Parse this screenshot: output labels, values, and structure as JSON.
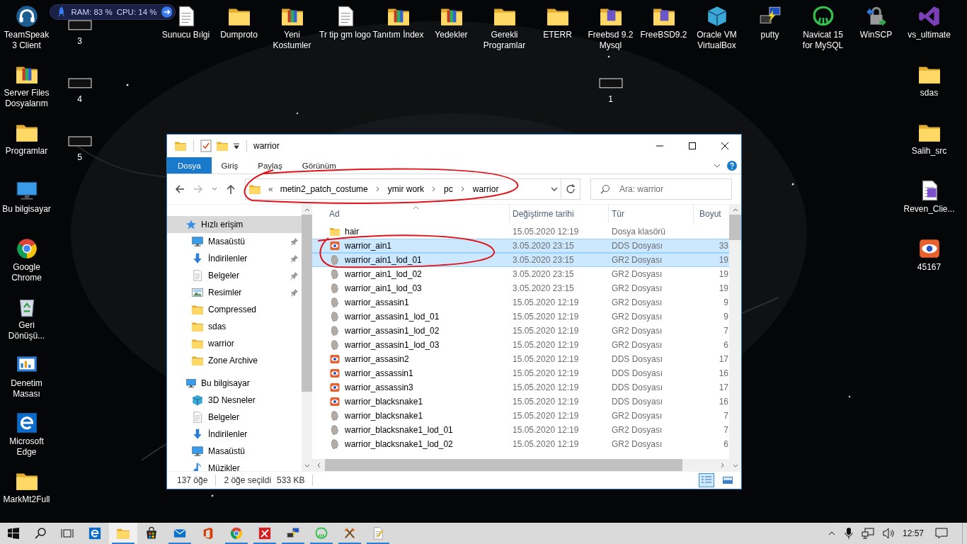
{
  "desktop": {
    "icons": [
      {
        "label": "TeamSpeak 3 Client",
        "kind": "headset"
      },
      {
        "label": "3",
        "kind": "thumb"
      },
      {
        "label": "Sunucu Bılgi",
        "kind": "document"
      },
      {
        "label": "Dumproto",
        "kind": "folder"
      },
      {
        "label": "Yeni Kostumler",
        "kind": "archive-folder"
      },
      {
        "label": "Tr tip gm logo",
        "kind": "document"
      },
      {
        "label": "Tanıtım İndex",
        "kind": "archive-folder"
      },
      {
        "label": "Yedekler",
        "kind": "archive-folder"
      },
      {
        "label": "Gerekli Programlar",
        "kind": "folder"
      },
      {
        "label": "ETERR",
        "kind": "folder"
      },
      {
        "label": "Freebsd 9.2 Mysql",
        "kind": "package-folder"
      },
      {
        "label": "FreeBSD9.2",
        "kind": "package-folder"
      },
      {
        "label": "Oracle VM VirtualBox",
        "kind": "vbox"
      },
      {
        "label": "putty",
        "kind": "putty"
      },
      {
        "label": "Navicat 15 for MySQL",
        "kind": "navicat"
      },
      {
        "label": "WinSCP",
        "kind": "winscp"
      },
      {
        "label": "vs_ultimate",
        "kind": "vs"
      },
      {
        "label": "Server Files Dosyalarım",
        "kind": "archive-folder"
      },
      {
        "label": "Programlar",
        "kind": "folder"
      },
      {
        "label": "Bu bilgisayar",
        "kind": "pc"
      },
      {
        "label": "Google Chrome",
        "kind": "chrome"
      },
      {
        "label": "Geri Dönüşü...",
        "kind": "recycle"
      },
      {
        "label": "Denetim Masası",
        "kind": "control"
      },
      {
        "label": "Microsoft Edge",
        "kind": "edge"
      },
      {
        "label": "MarkMt2Full",
        "kind": "folder"
      },
      {
        "label": "4",
        "kind": "thumb"
      },
      {
        "label": "5",
        "kind": "thumb"
      },
      {
        "label": "1",
        "kind": "thumb"
      },
      {
        "label": "sdas",
        "kind": "folder"
      },
      {
        "label": "Salih_src",
        "kind": "folder"
      },
      {
        "label": "Reven_Clie...",
        "kind": "doc-purple"
      },
      {
        "label": "45167",
        "kind": "eye"
      }
    ]
  },
  "system_monitor": {
    "ram": "RAM: 83 %",
    "cpu": "CPU: 14 %"
  },
  "window": {
    "title": "warrior",
    "ribbon_tabs": [
      {
        "label": "Dosya",
        "selected": true
      },
      {
        "label": "Giriş",
        "selected": false
      },
      {
        "label": "Paylaş",
        "selected": false
      },
      {
        "label": "Görünüm",
        "selected": false
      }
    ],
    "address": {
      "overflow": "«",
      "crumbs": [
        "metin2_patch_costume",
        "ymir work",
        "pc",
        "warrior"
      ]
    },
    "search": {
      "placeholder": "Ara: warrior"
    },
    "navigation": [
      {
        "label": "Hızlı erişim",
        "kind": "star",
        "selected": true,
        "children": [
          {
            "label": "Masaüstü",
            "kind": "desktop",
            "pinned": true,
            "selected": false
          },
          {
            "label": "İndirilenler",
            "kind": "download",
            "pinned": true,
            "selected": false
          },
          {
            "label": "Belgeler",
            "kind": "documents",
            "pinned": true,
            "selected": false
          },
          {
            "label": "Resimler",
            "kind": "pictures",
            "pinned": true,
            "selected": false
          },
          {
            "label": "Compressed",
            "kind": "folder",
            "pinned": false,
            "selected": false
          },
          {
            "label": "sdas",
            "kind": "folder",
            "pinned": false,
            "selected": false
          },
          {
            "label": "warrior",
            "kind": "folder",
            "pinned": false,
            "selected": false
          },
          {
            "label": "Zone Archive",
            "kind": "folder",
            "pinned": false,
            "selected": false
          }
        ]
      },
      {
        "label": "Bu bilgisayar",
        "kind": "pc",
        "selected": false,
        "children": [
          {
            "label": "3D Nesneler",
            "kind": "cube3d",
            "pinned": false,
            "selected": false
          },
          {
            "label": "Belgeler",
            "kind": "documents",
            "pinned": false,
            "selected": false
          },
          {
            "label": "İndirilenler",
            "kind": "download",
            "pinned": false,
            "selected": false
          },
          {
            "label": "Masaüstü",
            "kind": "desktop",
            "pinned": false,
            "selected": false
          },
          {
            "label": "Müzikler",
            "kind": "music",
            "pinned": false,
            "selected": false
          }
        ]
      }
    ],
    "columns": [
      "Ad",
      "Değiştirme tarihi",
      "Tür",
      "Boyut"
    ],
    "rows": [
      {
        "name": "hair",
        "date": "15.05.2020 12:19",
        "type": "Dosya klasörü",
        "kind": "folder",
        "selected": false
      },
      {
        "name": "warrior_ain1",
        "date": "3.05.2020 23:15",
        "type": "DDS Dosyası",
        "size": "33",
        "kind": "dds",
        "selected": true
      },
      {
        "name": "warrior_ain1_lod_01",
        "date": "3.05.2020 23:15",
        "type": "GR2 Dosyası",
        "size": "19",
        "kind": "gr2",
        "selected": true
      },
      {
        "name": "warrior_ain1_lod_02",
        "date": "3.05.2020 23:15",
        "type": "GR2 Dosyası",
        "size": "19",
        "kind": "gr2",
        "selected": false
      },
      {
        "name": "warrior_ain1_lod_03",
        "date": "3.05.2020 23:15",
        "type": "GR2 Dosyası",
        "size": "19",
        "kind": "gr2",
        "selected": false
      },
      {
        "name": "warrior_assasin1",
        "date": "15.05.2020 12:19",
        "type": "GR2 Dosyası",
        "size": "9",
        "kind": "gr2",
        "selected": false
      },
      {
        "name": "warrior_assasin1_lod_01",
        "date": "15.05.2020 12:19",
        "type": "GR2 Dosyası",
        "size": "9",
        "kind": "gr2",
        "selected": false
      },
      {
        "name": "warrior_assasin1_lod_02",
        "date": "15.05.2020 12:19",
        "type": "GR2 Dosyası",
        "size": "7",
        "kind": "gr2",
        "selected": false
      },
      {
        "name": "warrior_assasin1_lod_03",
        "date": "15.05.2020 12:19",
        "type": "GR2 Dosyası",
        "size": "6",
        "kind": "gr2",
        "selected": false
      },
      {
        "name": "warrior_assasin2",
        "date": "15.05.2020 12:19",
        "type": "DDS Dosyası",
        "size": "17",
        "kind": "dds",
        "selected": false
      },
      {
        "name": "warrior_assassin1",
        "date": "15.05.2020 12:19",
        "type": "DDS Dosyası",
        "size": "16",
        "kind": "dds",
        "selected": false
      },
      {
        "name": "warrior_assassin3",
        "date": "15.05.2020 12:19",
        "type": "DDS Dosyası",
        "size": "17",
        "kind": "dds",
        "selected": false
      },
      {
        "name": "warrior_blacksnake1",
        "date": "15.05.2020 12:19",
        "type": "DDS Dosyası",
        "size": "16",
        "kind": "dds",
        "selected": false
      },
      {
        "name": "warrior_blacksnake1",
        "date": "15.05.2020 12:19",
        "type": "GR2 Dosyası",
        "size": "7",
        "kind": "gr2",
        "selected": false
      },
      {
        "name": "warrior_blacksnake1_lod_01",
        "date": "15.05.2020 12:19",
        "type": "GR2 Dosyası",
        "size": "7",
        "kind": "gr2",
        "selected": false
      },
      {
        "name": "warrior_blacksnake1_lod_02",
        "date": "15.05.2020 12:19",
        "type": "GR2 Dosyası",
        "size": "6",
        "kind": "gr2",
        "selected": false
      }
    ],
    "status": {
      "item_count": "137 öğe",
      "selection": "2 öğe seçildi",
      "selection_size": "533 KB"
    },
    "view_buttons": [
      {
        "kind": "details",
        "selected": true
      },
      {
        "kind": "thumbnails",
        "selected": false
      }
    ],
    "annotations": [
      {
        "kind": "freehand-circle"
      },
      {
        "kind": "freehand-circle"
      }
    ]
  },
  "taskbar": {
    "apps": [
      {
        "kind": "edge",
        "running": false,
        "active": false
      },
      {
        "kind": "folder",
        "running": true,
        "active": true
      },
      {
        "kind": "store",
        "running": false,
        "active": false
      },
      {
        "kind": "mail",
        "running": true,
        "active": false
      },
      {
        "kind": "office",
        "running": false,
        "active": false
      },
      {
        "kind": "chrome",
        "running": true,
        "active": false
      },
      {
        "kind": "redapp",
        "running": true,
        "active": false
      },
      {
        "kind": "putty",
        "running": true,
        "active": false
      },
      {
        "kind": "navicat",
        "running": true,
        "active": false
      },
      {
        "kind": "axes",
        "running": true,
        "active": false
      },
      {
        "kind": "notepad",
        "running": true,
        "active": false
      }
    ],
    "clock": "12:57"
  }
}
